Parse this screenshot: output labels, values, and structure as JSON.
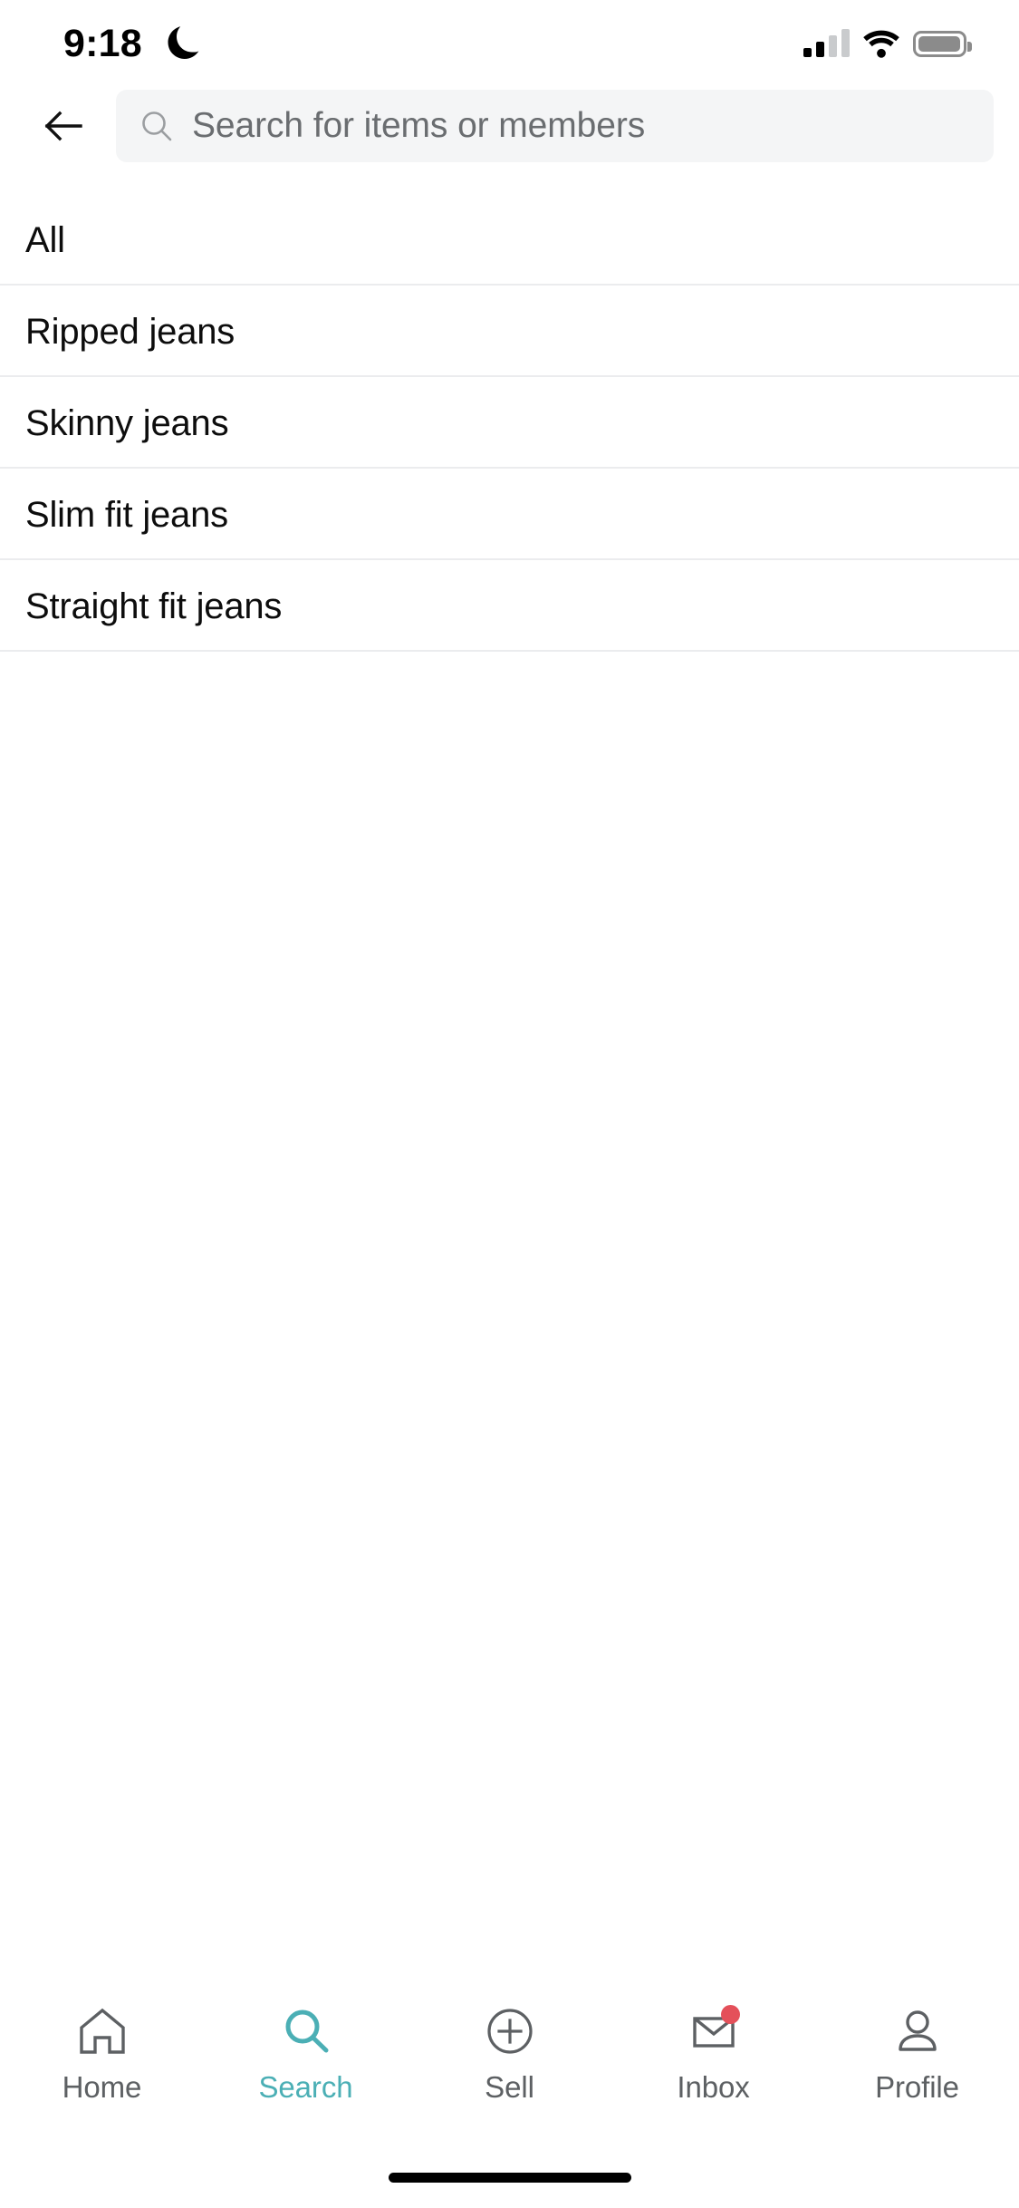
{
  "status_bar": {
    "time": "9:18",
    "dnd_icon": "crescent-moon-icon",
    "cellular_icon": "cellular-signal-icon",
    "cellular_bars_active": 2,
    "cellular_bars_total": 4,
    "wifi_icon": "wifi-icon",
    "battery_icon": "battery-icon",
    "battery_level_percent": 86
  },
  "header": {
    "back_icon": "arrow-left-icon",
    "search": {
      "icon": "search-icon",
      "value": "",
      "placeholder": "Search for items or members"
    }
  },
  "suggestions": {
    "items": [
      {
        "label": "All"
      },
      {
        "label": "Ripped jeans"
      },
      {
        "label": "Skinny jeans"
      },
      {
        "label": "Slim fit jeans"
      },
      {
        "label": "Straight fit jeans"
      }
    ]
  },
  "tab_bar": {
    "active_index": 1,
    "items": [
      {
        "label": "Home",
        "icon": "home-icon"
      },
      {
        "label": "Search",
        "icon": "search-icon"
      },
      {
        "label": "Sell",
        "icon": "plus-circle-icon"
      },
      {
        "label": "Inbox",
        "icon": "envelope-icon",
        "badge": true
      },
      {
        "label": "Profile",
        "icon": "person-icon"
      }
    ]
  },
  "colors": {
    "accent": "#4bafb5",
    "inactive": "#5d6063",
    "badge": "#e4505a",
    "divider": "#ebecee",
    "search_field_bg": "#f4f5f6",
    "placeholder_text": "#6a6d70",
    "primary_text": "#0d0d0d",
    "background": "#ffffff"
  },
  "home_indicator": {
    "present": true
  }
}
